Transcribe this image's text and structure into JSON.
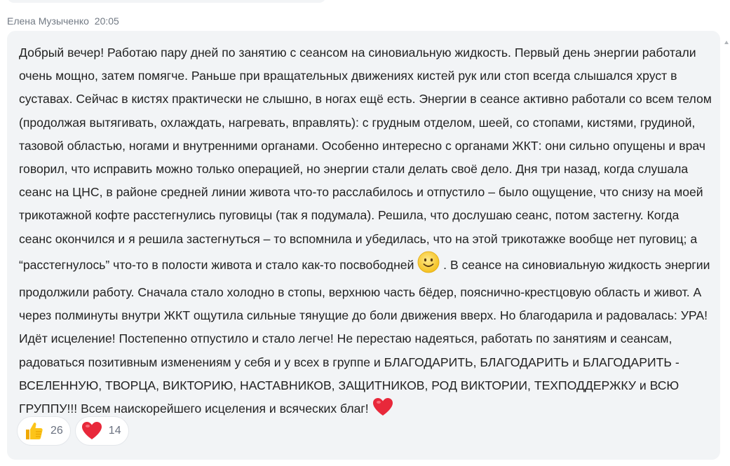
{
  "message": {
    "author": "Елена Музыченко",
    "time": "20:05",
    "segments": [
      "Добрый вечер! Работаю пару дней по занятию с сеансом на синовиальную жидкость. Первый день энергии работали очень мощно, затем помягче. Раньше при вращательных движениях кистей рук или стоп всегда слышался хруст в суставах. Сейчас в кистях практически не слышно, в ногах ещё есть. Энергии в сеансе активно работали со всем телом (продолжая вытягивать, охлаждать, нагревать, вправлять): с грудным отделом, шеей, со стопами, кистями, грудиной, тазовой областью, ногами и внутренними органами. Особенно интересно с органами ЖКТ: они сильно опущены и врач говорил, что исправить можно только операцией, но энергии стали делать своё дело. Дня три назад, когда слушала сеанс на ЦНС, в районе средней линии живота что-то расслабилось и отпустило – было ощущение, что снизу на моей трикотажной кофте расстегнулись пуговицы (так я подумала). Решила, что дослушаю сеанс, потом застегну. Когда сеанс окончился и я решила застегнуться – то вспомнила и убедилась, что на этой трикотажке вообще нет пуговиц; а “расстегнулось” что-то в полости живота и стало как-то посвободней ",
      " .  В сеансе на синовиальную жидкость энергии продолжили работу. Сначала стало холодно в стопы, верхнюю часть бёдер, пояснично-крестцовую область и живот. А через полминуты внутри ЖКТ ощутила сильные тянущие до боли движения вверх. Но благодарила и радовалась: УРА! Идёт исцеление! Постепенно отпустило и стало легче! Не перестаю надеяться, работать по занятиям и сеансам, радоваться позитивным изменениям у себя и у всех в группе и БЛАГОДАРИТЬ, БЛАГОДАРИТЬ и БЛАГОДАРИТЬ - ВСЕЛЕННУЮ, ТВОРЦА, ВИКТОРИЮ, НАСТАВНИКОВ, ЗАЩИТНИКОВ, РОД ВИКТОРИИ, ТЕХПОДДЕРЖКУ и ВСЮ ГРУППУ!!!   Всем наискорейшего исцеления и всяческих благ! "
    ],
    "inline_emojis": [
      "smile-emoji-icon",
      "heart-emoji-icon"
    ]
  },
  "reactions": [
    {
      "icon": "thumbs-up-icon",
      "count": "26"
    },
    {
      "icon": "heart-icon",
      "count": "14"
    }
  ],
  "colors": {
    "bubble": "#f2f4f6",
    "text": "#222222",
    "meta": "#727a84",
    "heart": "#e8283a",
    "thumb": "#f5b400"
  }
}
